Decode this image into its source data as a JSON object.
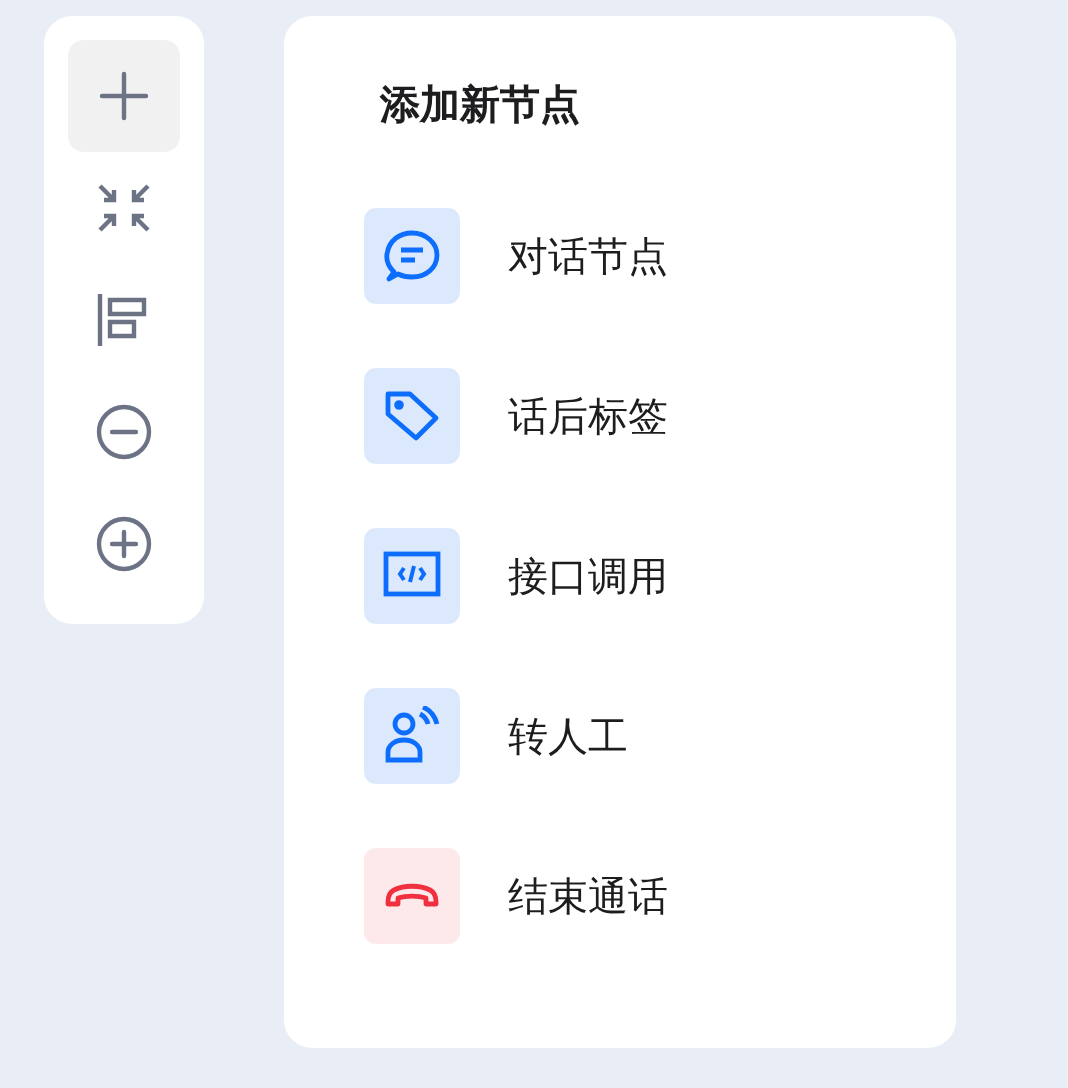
{
  "toolbar": {
    "buttons": [
      {
        "kind": "add",
        "selected": true
      },
      {
        "kind": "collapse",
        "selected": false
      },
      {
        "kind": "align",
        "selected": false
      },
      {
        "kind": "zoom_out",
        "selected": false
      },
      {
        "kind": "zoom_in",
        "selected": false
      }
    ]
  },
  "panel": {
    "title": "添加新节点",
    "items": [
      {
        "kind": "dialog",
        "label": "对话节点"
      },
      {
        "kind": "tag",
        "label": "话后标签"
      },
      {
        "kind": "api",
        "label": "接口调用"
      },
      {
        "kind": "human",
        "label": "转人工"
      },
      {
        "kind": "hangup",
        "label": "结束通话"
      }
    ]
  }
}
